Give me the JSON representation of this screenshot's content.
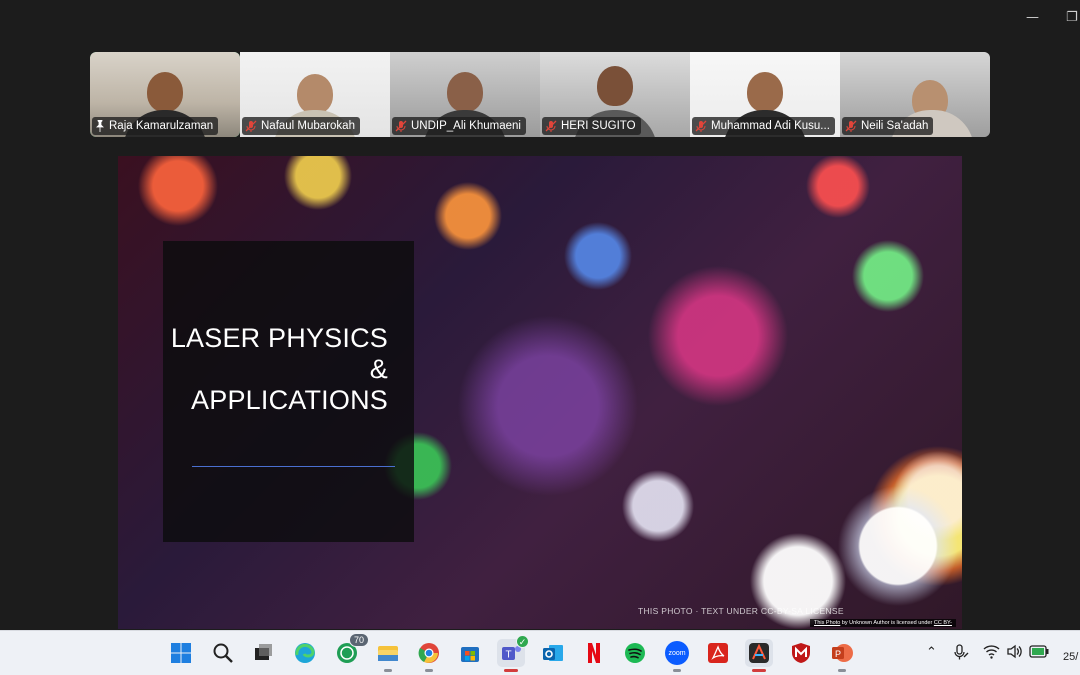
{
  "window": {
    "minimize_glyph": "—",
    "maximize_glyph": "❐"
  },
  "participants": [
    {
      "name": "Raja Kamarulzaman",
      "muted": false,
      "pinned": true,
      "active": true
    },
    {
      "name": "Nafaul Mubarokah",
      "muted": true,
      "pinned": false,
      "active": false
    },
    {
      "name": "UNDIP_Ali Khumaeni",
      "muted": true,
      "pinned": false,
      "active": false
    },
    {
      "name": "HERI SUGITO",
      "muted": true,
      "pinned": false,
      "active": false
    },
    {
      "name": "Muhammad Adi Kusu...",
      "muted": true,
      "pinned": false,
      "active": false
    },
    {
      "name": "Neili Sa'adah",
      "muted": true,
      "pinned": false,
      "active": false
    }
  ],
  "slide": {
    "title_line1": "LASER PHYSICS &",
    "title_line2": "APPLICATIONS",
    "caption": "THIS PHOTO · TEXT UNDER CC-BY-SA LICENSE",
    "attribution_link": "This Photo",
    "attribution_text": " by Unknown Author is licensed under ",
    "attribution_license": "CC BY-"
  },
  "taskbar": {
    "icons": [
      {
        "name": "windows-start-icon"
      },
      {
        "name": "search-icon"
      },
      {
        "name": "task-view-icon"
      },
      {
        "name": "edge-icon"
      },
      {
        "name": "whatsapp-icon",
        "badge": "70"
      },
      {
        "name": "file-explorer-icon"
      },
      {
        "name": "chrome-icon"
      },
      {
        "name": "microsoft-store-icon"
      },
      {
        "name": "teams-icon"
      },
      {
        "name": "outlook-icon"
      },
      {
        "name": "netflix-icon"
      },
      {
        "name": "spotify-icon"
      },
      {
        "name": "zoom-icon",
        "label": "zoom"
      },
      {
        "name": "acrobat-icon"
      },
      {
        "name": "app-active-icon"
      },
      {
        "name": "mcafee-icon"
      },
      {
        "name": "powerpoint-icon"
      }
    ],
    "clock": "25/"
  },
  "colors": {
    "active_tile": "#36d27e",
    "mic_off": "#e0453a",
    "taskbar_bg": "#eef1f6"
  }
}
